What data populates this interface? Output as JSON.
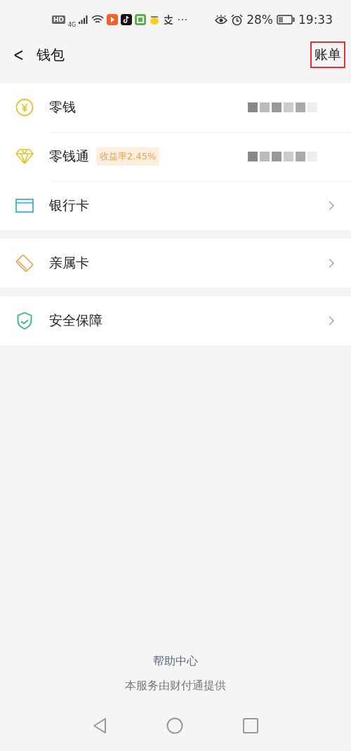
{
  "status_bar": {
    "left": [
      "HD",
      "4G"
    ],
    "more": "⋯",
    "battery_percent": "28%",
    "time": "19:33"
  },
  "header": {
    "back": "<",
    "title": "钱包",
    "action": {
      "label": "账单",
      "highlighted": true
    }
  },
  "sections": [
    {
      "items": [
        {
          "label": "零钱",
          "kind": "amount"
        },
        {
          "label": "零钱通",
          "badge": "收益率2.45%",
          "kind": "amount"
        },
        {
          "label": "银行卡",
          "kind": "link"
        }
      ]
    },
    {
      "items": [
        {
          "label": "亲属卡",
          "kind": "link"
        }
      ]
    },
    {
      "items": [
        {
          "label": "安全保障",
          "kind": "link"
        }
      ]
    }
  ],
  "footer": {
    "help": "帮助中心",
    "provider": "本服务由财付通提供"
  }
}
